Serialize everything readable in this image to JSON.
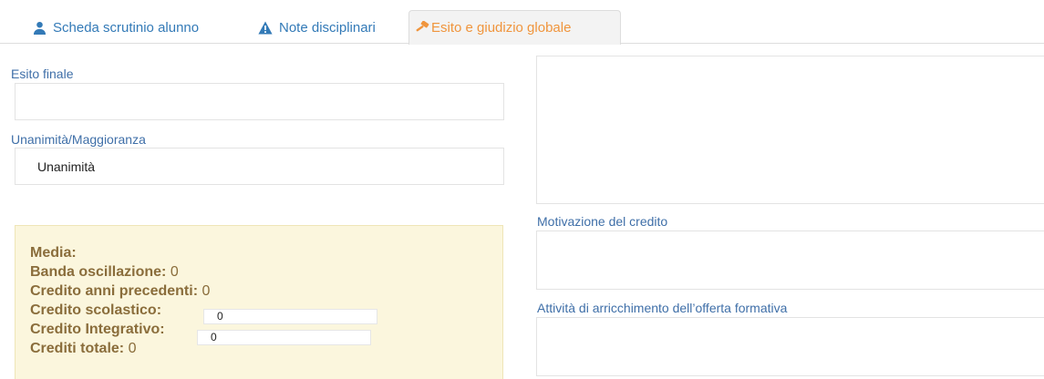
{
  "tabs": [
    {
      "label": "Scheda scrutinio alunno",
      "icon": "user-icon"
    },
    {
      "label": "Note disciplinari",
      "icon": "warning-icon"
    },
    {
      "label": "Esito e giudizio globale",
      "icon": "gavel-icon",
      "active": true
    }
  ],
  "left": {
    "esito_label": "Esito finale",
    "esito_value": "",
    "maggioranza_label": "Unanimità/Maggioranza",
    "maggioranza_value": "Unanimità"
  },
  "crediti": {
    "media_label": "Media:",
    "media_value": "",
    "banda_label": "Banda oscillazione:",
    "banda_value": "0",
    "anni_precedenti_label": "Credito anni precedenti:",
    "anni_precedenti_value": "0",
    "scolastico_label": "Credito scolastico:",
    "scolastico_value": "0",
    "integrativo_label": "Credito Integrativo:",
    "integrativo_value": "0",
    "totale_label": "Crediti totale:",
    "totale_value": "0"
  },
  "right": {
    "giudizio_value": "",
    "motivazione_label": "Motivazione del credito",
    "motivazione_value": "",
    "attivita_label": "Attività di arricchimento dell’offerta formativa",
    "attivita_value": ""
  },
  "colors": {
    "link_blue": "#337ab7",
    "label_blue": "#3f6fa8",
    "active_orange": "#f0953d",
    "well_bg": "#fbf6dd",
    "well_text": "#8a6d3b"
  }
}
